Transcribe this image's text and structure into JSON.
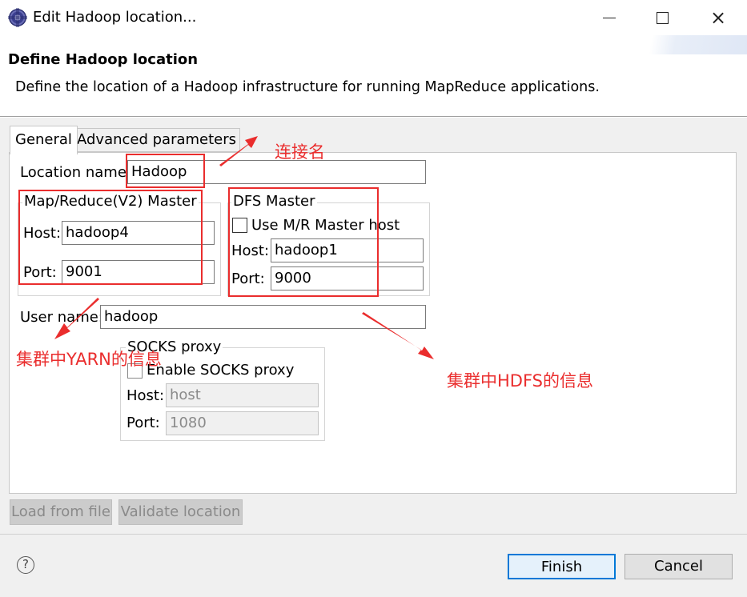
{
  "window": {
    "title": "Edit Hadoop location...",
    "controls": {
      "minimize": "minimize-icon",
      "maximize": "maximize-icon",
      "close": "×"
    }
  },
  "header": {
    "title": "Define Hadoop location",
    "description": "Define the location of a Hadoop infrastructure for running MapReduce applications."
  },
  "tabs": [
    "General",
    "Advanced parameters"
  ],
  "general": {
    "location_name_label": "Location name:",
    "location_name_value": "Hadoop",
    "mapreduce": {
      "title": "Map/Reduce(V2) Master",
      "host_label": "Host:",
      "host_value": "hadoop4",
      "port_label": "Port:",
      "port_value": "9001"
    },
    "dfs": {
      "title": "DFS Master",
      "use_mr_label": "Use M/R Master host",
      "use_mr_checked": false,
      "host_label": "Host:",
      "host_value": "hadoop1",
      "port_label": "Port:",
      "port_value": "9000"
    },
    "user_name_label": "User name:",
    "user_name_value": "hadoop",
    "socks": {
      "title": "SOCKS proxy",
      "enable_label": "Enable SOCKS proxy",
      "enable_checked": false,
      "host_label": "Host:",
      "host_value": "host",
      "port_label": "Port:",
      "port_value": "1080"
    }
  },
  "annotations": {
    "connection_name": "连接名",
    "yarn_info": "集群中YARN的信息",
    "hdfs_info": "集群中HDFS的信息",
    "color": "#ea2d2d"
  },
  "buttons": {
    "load_from_file": "Load from file",
    "validate_location": "Validate location",
    "finish": "Finish",
    "cancel": "Cancel",
    "help": "?"
  }
}
